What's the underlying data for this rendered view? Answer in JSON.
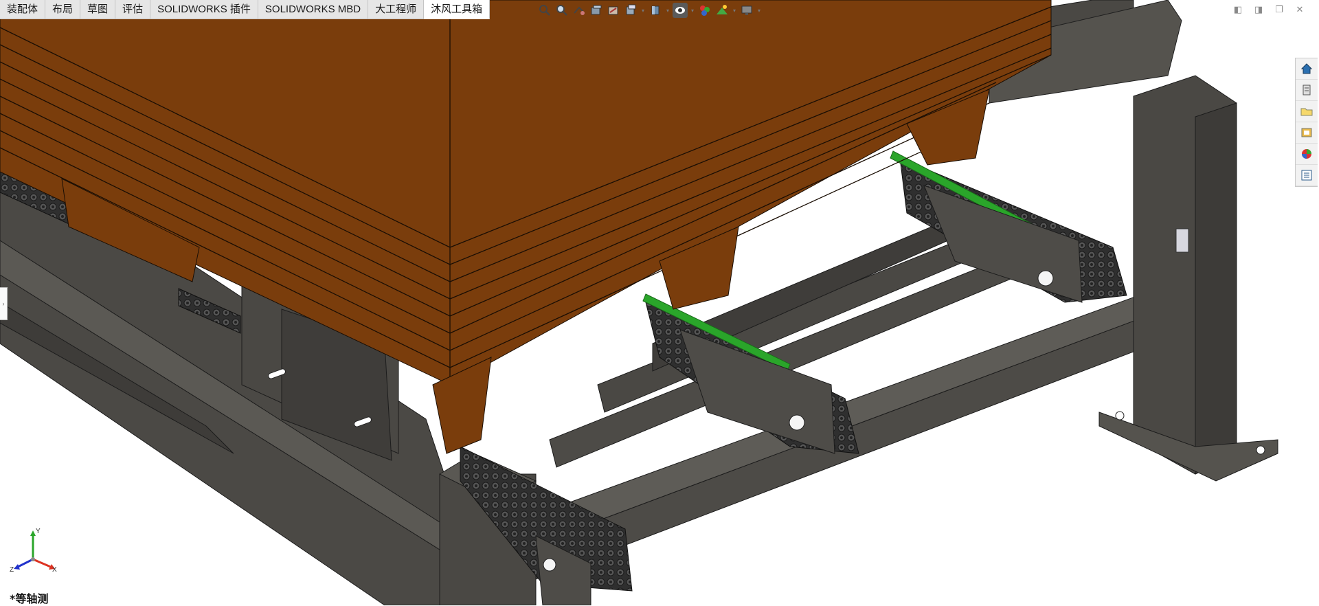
{
  "tabs": [
    {
      "label": "装配体",
      "active": false
    },
    {
      "label": "布局",
      "active": false
    },
    {
      "label": "草图",
      "active": false
    },
    {
      "label": "评估",
      "active": false
    },
    {
      "label": "SOLIDWORKS 插件",
      "active": false
    },
    {
      "label": "SOLIDWORKS MBD",
      "active": false
    },
    {
      "label": "大工程师",
      "active": false
    },
    {
      "label": "沐风工具箱",
      "active": true
    }
  ],
  "hud_icons": [
    "zoom-to-fit-icon",
    "zoom-to-area-icon",
    "previous-view-icon",
    "section-view-icon",
    "dynamic-annotation-icon",
    "view-orientation-icon",
    "display-style-icon",
    "hide-show-items-icon",
    "edit-appearance-icon",
    "apply-scene-icon",
    "view-settings-icon"
  ],
  "task_pane_icons": [
    "home-icon",
    "design-library-icon",
    "file-explorer-icon",
    "view-palette-icon",
    "appearances-icon",
    "custom-properties-icon"
  ],
  "triad": {
    "x": "X",
    "y": "Y",
    "z": "Z"
  },
  "view_name": "*等轴测",
  "colors": {
    "frame": "#4a4844",
    "frame_light": "#5a5853",
    "pallet": "#7a3d0c",
    "chain": "#3a3a3a",
    "guide_rail": "#2aa52a",
    "background": "#ffffff"
  }
}
